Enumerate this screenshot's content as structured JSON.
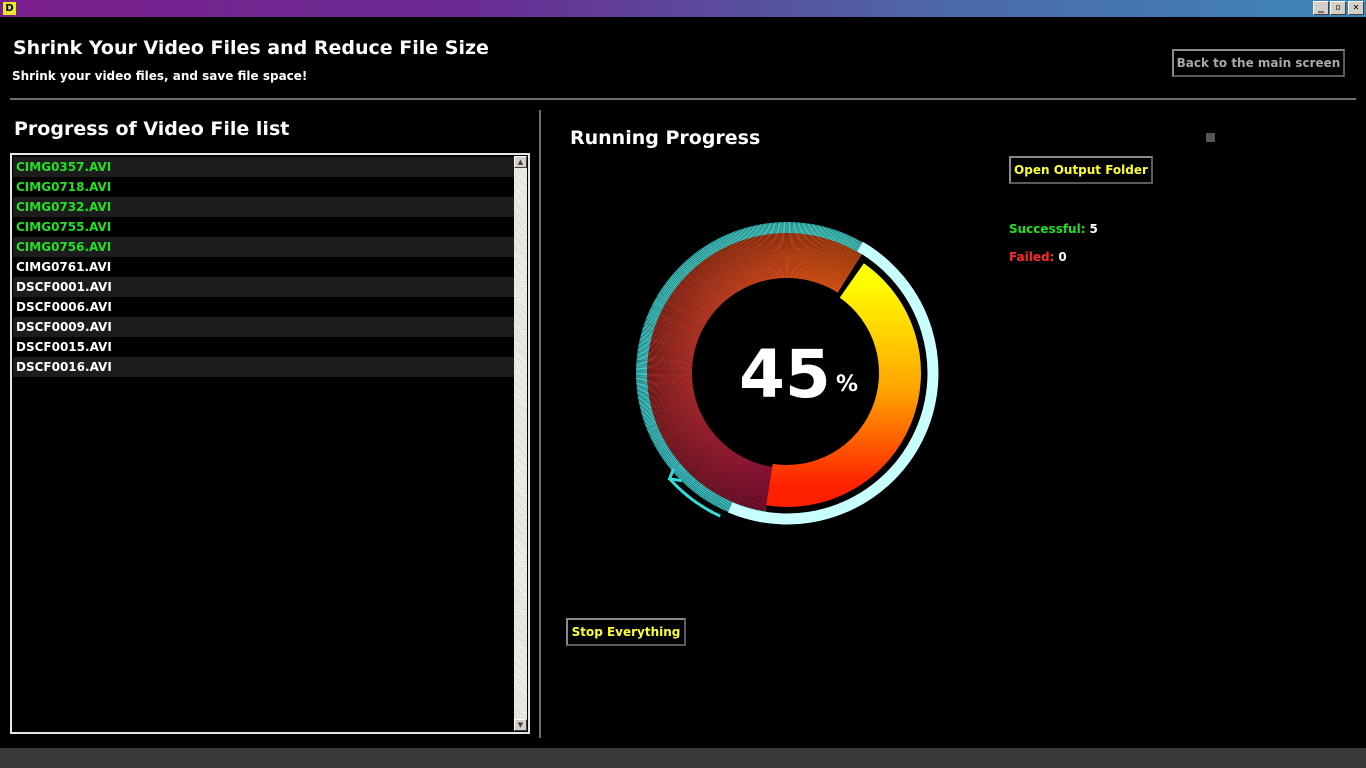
{
  "window": {
    "icon_letter": "D",
    "controls": {
      "minimize": "_",
      "maximize": "▫",
      "close": "✕"
    }
  },
  "header": {
    "title": "Shrink Your Video Files and Reduce File Size",
    "subtitle": "Shrink your video files, and save file space!",
    "back_button": "Back to the main screen"
  },
  "file_list": {
    "title": "Progress of Video File list",
    "files": [
      {
        "name": "CIMG0357.AVI",
        "status": "done"
      },
      {
        "name": "CIMG0718.AVI",
        "status": "done"
      },
      {
        "name": "CIMG0732.AVI",
        "status": "done"
      },
      {
        "name": "CIMG0755.AVI",
        "status": "done"
      },
      {
        "name": "CIMG0756.AVI",
        "status": "done"
      },
      {
        "name": "CIMG0761.AVI",
        "status": "pending"
      },
      {
        "name": "DSCF0001.AVI",
        "status": "pending"
      },
      {
        "name": "DSCF0006.AVI",
        "status": "pending"
      },
      {
        "name": "DSCF0009.AVI",
        "status": "pending"
      },
      {
        "name": "DSCF0015.AVI",
        "status": "pending"
      },
      {
        "name": "DSCF0016.AVI",
        "status": "pending"
      }
    ]
  },
  "progress": {
    "title": "Running Progress",
    "percent_value": "45",
    "percent_fraction": 0.45,
    "percent_sign": "%",
    "open_output_button": "Open Output Folder",
    "stop_button": "Stop Everything",
    "successful_label": "Successful:",
    "successful_count": "5",
    "failed_label": "Failed:",
    "failed_count": "0"
  },
  "colors": {
    "done_text": "#22e022",
    "pending_text": "#ffffff",
    "failed_label": "#ff2a2a",
    "button_text": "#ffff33",
    "gauge_track": "#c8ffff",
    "gauge_ticks": "#33dddd"
  }
}
